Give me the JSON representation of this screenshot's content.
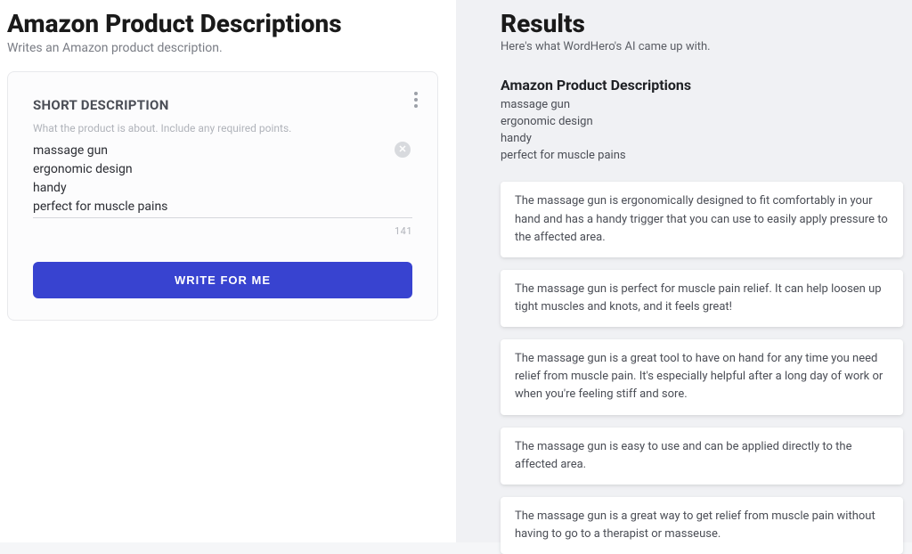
{
  "left": {
    "title": "Amazon Product Descriptions",
    "subtitle": "Writes an Amazon product description.",
    "card": {
      "field_label": "SHORT DESCRIPTION",
      "field_help": "What the product is about. Include any required points.",
      "input_value": "massage gun\nergonomic design\nhandy\nperfect for muscle pains",
      "char_count": "141",
      "button_label": "WRITE FOR ME"
    }
  },
  "right": {
    "title": "Results",
    "subtitle": "Here's what WordHero's AI came up with.",
    "heading": "Amazon Product Descriptions",
    "keywords": "massage gun\nergonomic design\nhandy\nperfect for muscle pains",
    "cards": [
      "The massage gun is ergonomically designed to fit comfortably in your hand and has a handy trigger that you can use to easily apply pressure to the affected area.",
      "The massage gun is perfect for muscle pain relief. It can help loosen up tight muscles and knots, and it feels great!",
      "The massage gun is a great tool to have on hand for any time you need relief from muscle pain. It's especially helpful after a long day of work or when you're feeling stiff and sore.",
      "The massage gun is easy to use and can be applied directly to the affected area.",
      "The massage gun is a great way to get relief from muscle pain without having to go to a therapist or masseuse."
    ]
  }
}
